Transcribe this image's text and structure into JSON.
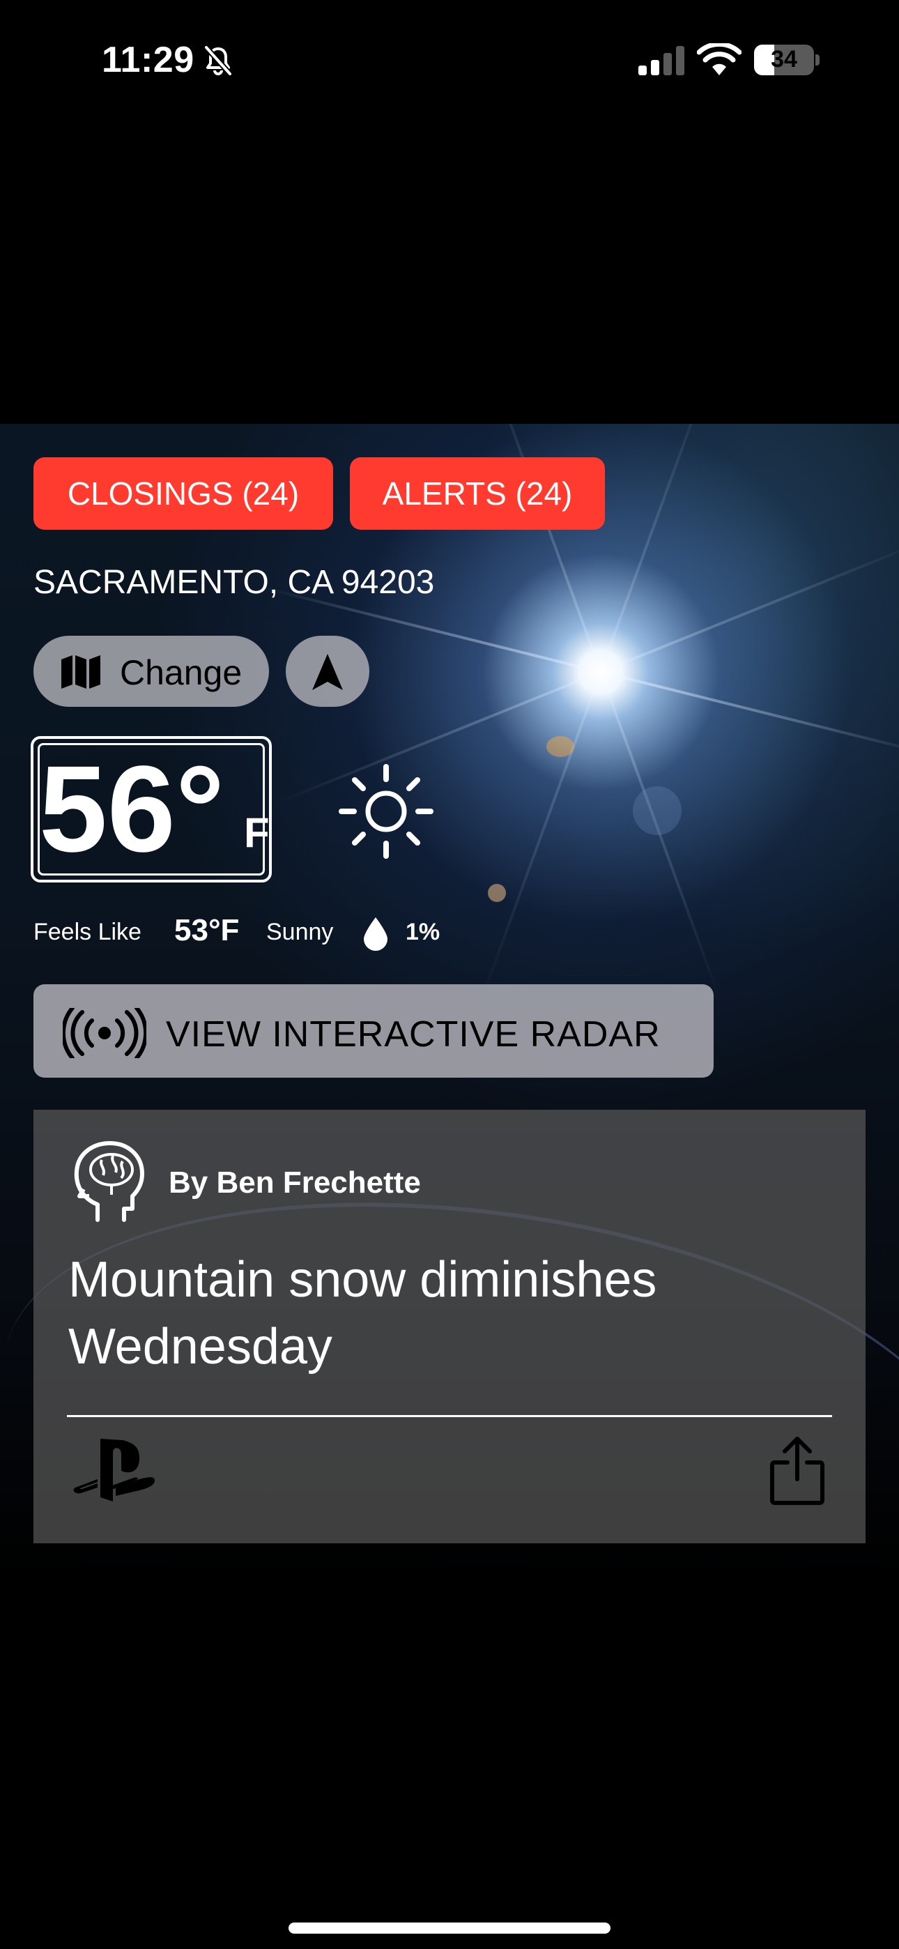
{
  "status_bar": {
    "time": "11:29",
    "battery_level": "34",
    "battery_fraction": 0.34,
    "icons": [
      "bell-slash-icon",
      "cellular-signal-icon",
      "wifi-icon",
      "battery-icon"
    ]
  },
  "buttons": {
    "closings": "CLOSINGS (24)",
    "alerts": "ALERTS (24)",
    "change": "Change",
    "radar": "VIEW INTERACTIVE RADAR"
  },
  "location": {
    "city": "SACRAMENTO, CA 94203"
  },
  "current": {
    "temperature": "56°",
    "unit": "F",
    "feels_like_label": "Feels Like",
    "feels_like_value": "53°F",
    "condition": "Sunny",
    "precip": "1%",
    "condition_icon": "sun-icon"
  },
  "article": {
    "author": "By Ben Frechette",
    "headline": "Mountain snow diminishes Wednesday"
  },
  "colors": {
    "alert_red": "#ff3b30",
    "chip_gray": "#aaaab2",
    "card_gray": "#585858"
  }
}
